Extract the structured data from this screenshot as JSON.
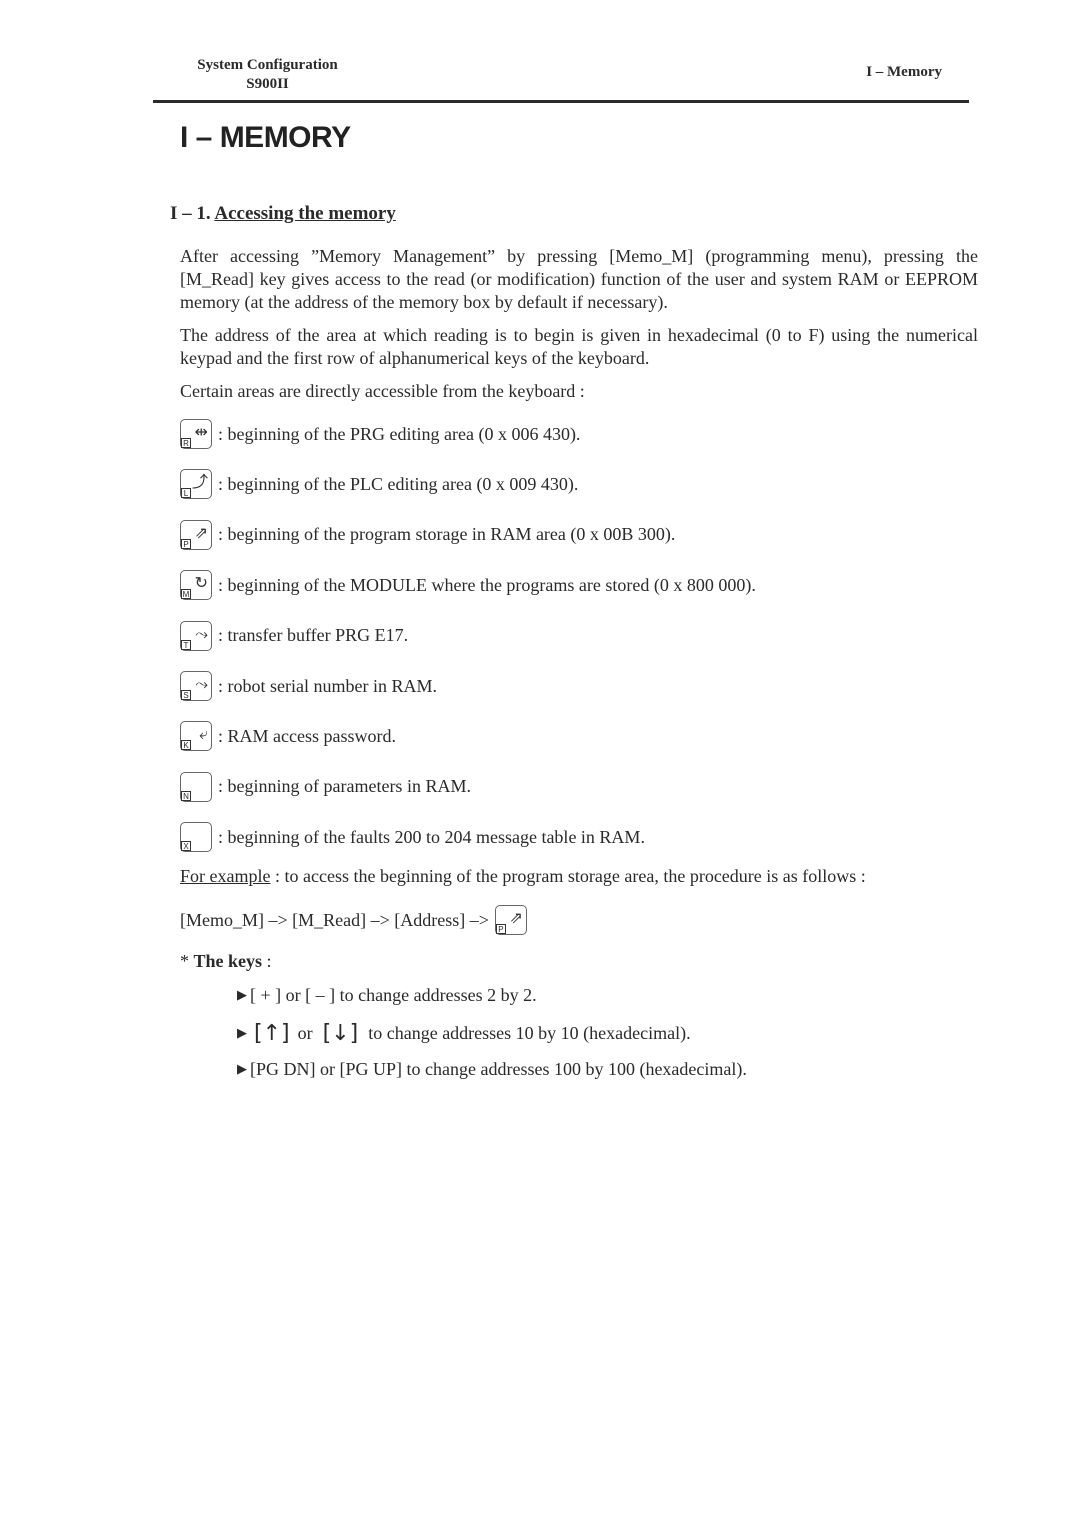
{
  "header": {
    "doc_title": "System Configuration",
    "model": "S900II",
    "chapter": "I – Memory"
  },
  "title": "I – MEMORY",
  "section": {
    "number": "I – 1.",
    "title": "Accessing the memory"
  },
  "paragraphs": [
    "After accessing ”Memory Management” by pressing [Memo_M] (programming menu), pressing the [M_Read] key gives access to the read (or modification) function of the user and system RAM or EEPROM  memory (at the address of the memory box by default if necessary).",
    "The address of the area at which reading is to begin is given in hexadecimal (0 to F) using the numerical keypad and the first row of alphanumerical keys of the keyboard.",
    "Certain areas are directly accessible from the keyboard :"
  ],
  "key_areas": [
    {
      "icon": "prg-edit-key-icon",
      "letter": "R",
      "glyph": "⇹",
      "text": ": beginning of the PRG editing area (0 x 006 430)."
    },
    {
      "icon": "plc-edit-key-icon",
      "letter": "L",
      "glyph": "⤴",
      "text": ": beginning of the PLC editing area (0 x 009 430)."
    },
    {
      "icon": "program-storage-key-icon",
      "letter": "P",
      "glyph": "⇗",
      "text": ": beginning of the program storage in RAM area (0 x 00B 300)."
    },
    {
      "icon": "module-key-icon",
      "letter": "M",
      "glyph": "↻",
      "text": ": beginning of the MODULE where the programs are stored (0 x 800 000)."
    },
    {
      "icon": "transfer-buffer-key-icon",
      "letter": "T",
      "glyph": "⤳",
      "text": ": transfer buffer PRG E17."
    },
    {
      "icon": "serial-number-key-icon",
      "letter": "S",
      "glyph": "⤳",
      "text": ": robot serial number in RAM."
    },
    {
      "icon": "password-key-icon",
      "letter": "K",
      "glyph": "⤶",
      "text": ": RAM access password."
    },
    {
      "icon": "parameters-key-icon",
      "letter": "N",
      "glyph": "",
      "text": ": beginning of parameters in RAM."
    },
    {
      "icon": "faults-key-icon",
      "letter": "X",
      "glyph": "",
      "text": ": beginning of the faults 200 to 204 message table in RAM."
    }
  ],
  "example": {
    "label": "For example",
    "text": " : to access the beginning of the program storage area, the procedure is as follows :",
    "procedure": "[Memo_M] –> [M_Read] –> [Address] –>",
    "proc_key_letter": "P",
    "proc_key_glyph": "⇗"
  },
  "keys_section": {
    "prefix": "* ",
    "title": "The keys",
    "suffix": " :",
    "bullets": [
      "[ + ] or [ – ] to change addresses 2 by 2.",
      "to change addresses 10 by 10 (hexadecimal).",
      "[PG DN] or [PG UP] to change addresses 100 by 100 (hexadecimal)."
    ],
    "arrow_up": "[↑]",
    "arrow_or": "or",
    "arrow_down": "[↓]"
  }
}
